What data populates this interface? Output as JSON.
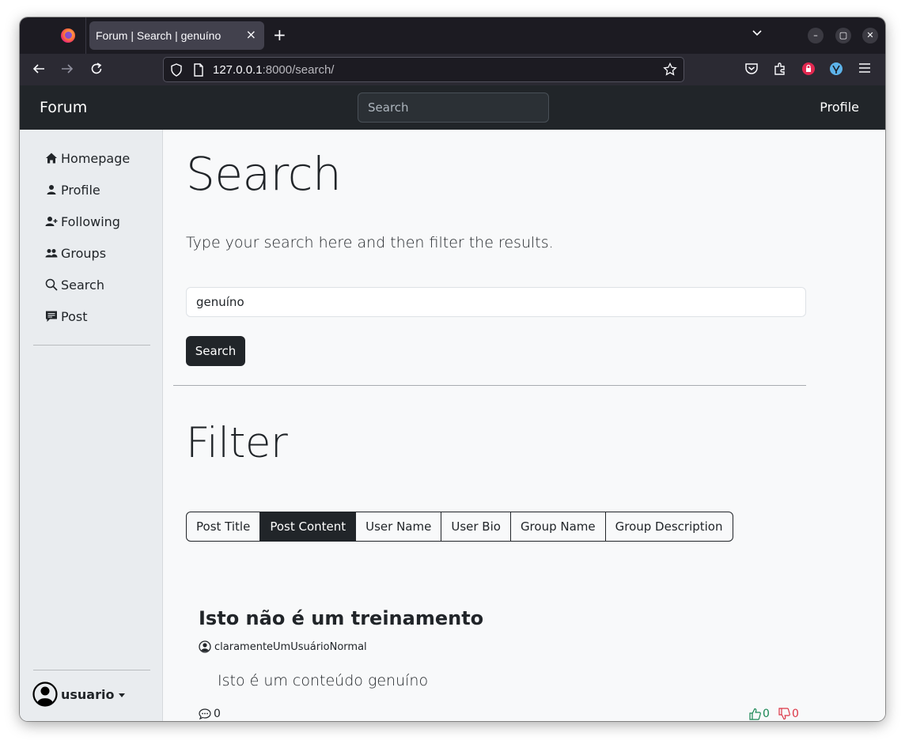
{
  "browser": {
    "tab_title": "Forum | Search | genuíno",
    "tab_close": "×",
    "new_tab": "+",
    "url_host": "127.0.0.1",
    "url_path": ":8000/search/",
    "window_controls": [
      "–",
      "▢",
      "✕"
    ]
  },
  "navbar": {
    "brand": "Forum",
    "search_placeholder": "Search",
    "profile": "Profile"
  },
  "sidebar": {
    "items": [
      {
        "label": "Homepage",
        "icon": "house-icon"
      },
      {
        "label": "Profile",
        "icon": "person-icon"
      },
      {
        "label": "Following",
        "icon": "person-plus-icon"
      },
      {
        "label": "Groups",
        "icon": "people-icon"
      },
      {
        "label": "Search",
        "icon": "search-icon"
      },
      {
        "label": "Post",
        "icon": "chat-square-text-icon"
      }
    ],
    "user": "usuario"
  },
  "main": {
    "heading": "Search",
    "lead": "Type your search here and then filter the results.",
    "query_value": "genuíno",
    "search_button": "Search",
    "filter_heading": "Filter",
    "filters": [
      {
        "label": "Post Title",
        "active": false
      },
      {
        "label": "Post Content",
        "active": true
      },
      {
        "label": "User Name",
        "active": false
      },
      {
        "label": "User Bio",
        "active": false
      },
      {
        "label": "Group Name",
        "active": false
      },
      {
        "label": "Group Description",
        "active": false
      }
    ]
  },
  "result": {
    "title": "Isto não é um treinamento",
    "author": "claramenteUmUsuárioNormal",
    "content": "Isto é um conteúdo genuíno",
    "comments": "0",
    "likes": "0",
    "dislikes": "0",
    "like_color": "#198754",
    "dislike_color": "#dc3545"
  }
}
